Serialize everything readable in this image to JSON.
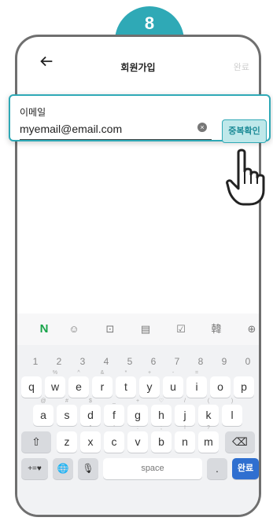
{
  "step_badge": "8",
  "header": {
    "title": "회원가입",
    "done": "완료"
  },
  "email": {
    "label": "이메일",
    "value": "myemail@email.com",
    "check_button": "중복확인"
  },
  "keyboard": {
    "toolbar": [
      "N",
      "☺",
      "⊡",
      "▤",
      "☑",
      "韓",
      "⊕"
    ],
    "numbers": [
      "1",
      "2",
      "3",
      "4",
      "5",
      "6",
      "7",
      "8",
      "9",
      "0"
    ],
    "row1": [
      {
        "k": "q",
        "h": ""
      },
      {
        "k": "w",
        "h": "%"
      },
      {
        "k": "e",
        "h": "^"
      },
      {
        "k": "r",
        "h": "&"
      },
      {
        "k": "t",
        "h": "*"
      },
      {
        "k": "y",
        "h": "+"
      },
      {
        "k": "u",
        "h": "-"
      },
      {
        "k": "i",
        "h": "="
      },
      {
        "k": "o",
        "h": ""
      },
      {
        "k": "p",
        "h": ""
      }
    ],
    "row2": [
      {
        "k": "a",
        "h": "@"
      },
      {
        "k": "s",
        "h": "#"
      },
      {
        "k": "d",
        "h": "$"
      },
      {
        "k": "f",
        "h": "_"
      },
      {
        "k": "g",
        "h": "+"
      },
      {
        "k": "h",
        "h": "♡"
      },
      {
        "k": "j",
        "h": "/"
      },
      {
        "k": "k",
        "h": "("
      },
      {
        "k": "l",
        "h": ")"
      }
    ],
    "row3": [
      {
        "k": "z",
        "h": ""
      },
      {
        "k": "x",
        "h": "\""
      },
      {
        "k": "c",
        "h": "'"
      },
      {
        "k": "v",
        "h": ":"
      },
      {
        "k": "b",
        "h": ";"
      },
      {
        "k": "n",
        "h": "!"
      },
      {
        "k": "m",
        "h": "?"
      }
    ],
    "shift": "⇧",
    "backspace": "⌫",
    "symbols": "+=♥",
    "globe": "🌐",
    "mic": "🎙",
    "space": "space",
    "period": ".",
    "enter": "완료"
  }
}
